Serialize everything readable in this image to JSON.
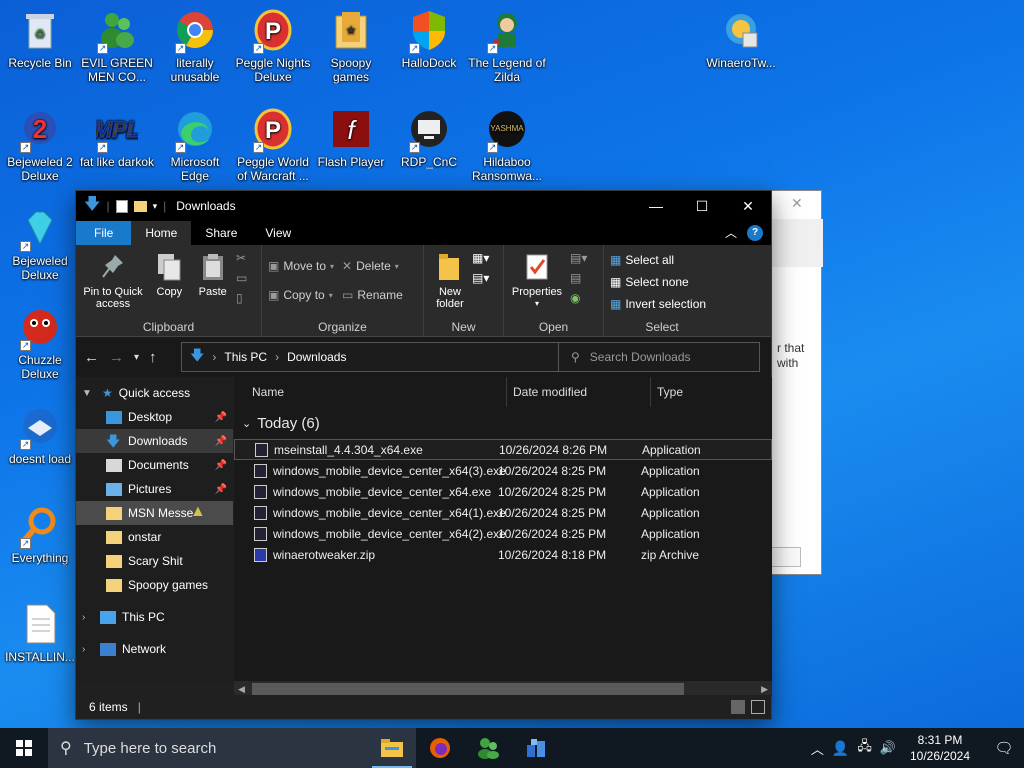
{
  "desktop": {
    "icons": [
      {
        "label": "Recycle Bin"
      },
      {
        "label": "EVIL GREEN MEN CO..."
      },
      {
        "label": "literally unusable"
      },
      {
        "label": "Peggle Nights Deluxe"
      },
      {
        "label": "Spoopy games"
      },
      {
        "label": "HalloDock"
      },
      {
        "label": "The Legend of Zilda"
      },
      {
        "label": "WinaeroTw..."
      },
      {
        "label": "Bejeweled 2 Deluxe"
      },
      {
        "label": "fat like darkok"
      },
      {
        "label": "Microsoft Edge"
      },
      {
        "label": "Peggle World of Warcraft ..."
      },
      {
        "label": "Flash Player"
      },
      {
        "label": "RDP_CnC"
      },
      {
        "label": "Hildaboo Ransomwa..."
      },
      {
        "label": "Bejeweled Deluxe"
      },
      {
        "label": "Chuzzle Deluxe"
      },
      {
        "label": "doesnt load"
      },
      {
        "label": "Everything"
      },
      {
        "label": "INSTALLIN..."
      }
    ],
    "bg_window_text": [
      "r that",
      "with"
    ]
  },
  "explorer": {
    "title": "Downloads",
    "tabs": [
      "File",
      "Home",
      "Share",
      "View"
    ],
    "ribbon": {
      "clipboard": {
        "pin": "Pin to Quick access",
        "copy": "Copy",
        "paste": "Paste",
        "label": "Clipboard"
      },
      "organize": {
        "move_to": "Move to",
        "copy_to": "Copy to",
        "delete": "Delete",
        "rename": "Rename",
        "label": "Organize"
      },
      "new": {
        "new_folder": "New folder",
        "label": "New"
      },
      "open": {
        "properties": "Properties",
        "label": "Open"
      },
      "select": {
        "select_all": "Select all",
        "select_none": "Select none",
        "invert": "Invert selection",
        "label": "Select"
      }
    },
    "address": {
      "crumbs": [
        "This PC",
        "Downloads"
      ],
      "search_placeholder": "Search Downloads"
    },
    "nav": {
      "quick_access": "Quick access",
      "items": [
        {
          "label": "Desktop",
          "pinned": true
        },
        {
          "label": "Downloads",
          "pinned": true
        },
        {
          "label": "Documents",
          "pinned": true
        },
        {
          "label": "Pictures",
          "pinned": true
        },
        {
          "label": "MSN Messe",
          "pinned": false
        },
        {
          "label": "onstar",
          "pinned": false
        },
        {
          "label": "Scary Shit",
          "pinned": false
        },
        {
          "label": "Spoopy games",
          "pinned": false
        }
      ],
      "this_pc": "This PC",
      "network": "Network"
    },
    "columns": {
      "name": "Name",
      "date": "Date modified",
      "type": "Type"
    },
    "group": "Today (6)",
    "files": [
      {
        "name": "mseinstall_4.4.304_x64.exe",
        "date": "10/26/2024 8:26 PM",
        "type": "Application"
      },
      {
        "name": "windows_mobile_device_center_x64(3).exe",
        "date": "10/26/2024 8:25 PM",
        "type": "Application"
      },
      {
        "name": "windows_mobile_device_center_x64.exe",
        "date": "10/26/2024 8:25 PM",
        "type": "Application"
      },
      {
        "name": "windows_mobile_device_center_x64(1).exe",
        "date": "10/26/2024 8:25 PM",
        "type": "Application"
      },
      {
        "name": "windows_mobile_device_center_x64(2).exe",
        "date": "10/26/2024 8:25 PM",
        "type": "Application"
      },
      {
        "name": "winaerotweaker.zip",
        "date": "10/26/2024 8:18 PM",
        "type": "zip Archive"
      }
    ],
    "status": "6 items"
  },
  "taskbar": {
    "search_placeholder": "Type here to search",
    "time": "8:31 PM",
    "date": "10/26/2024"
  }
}
